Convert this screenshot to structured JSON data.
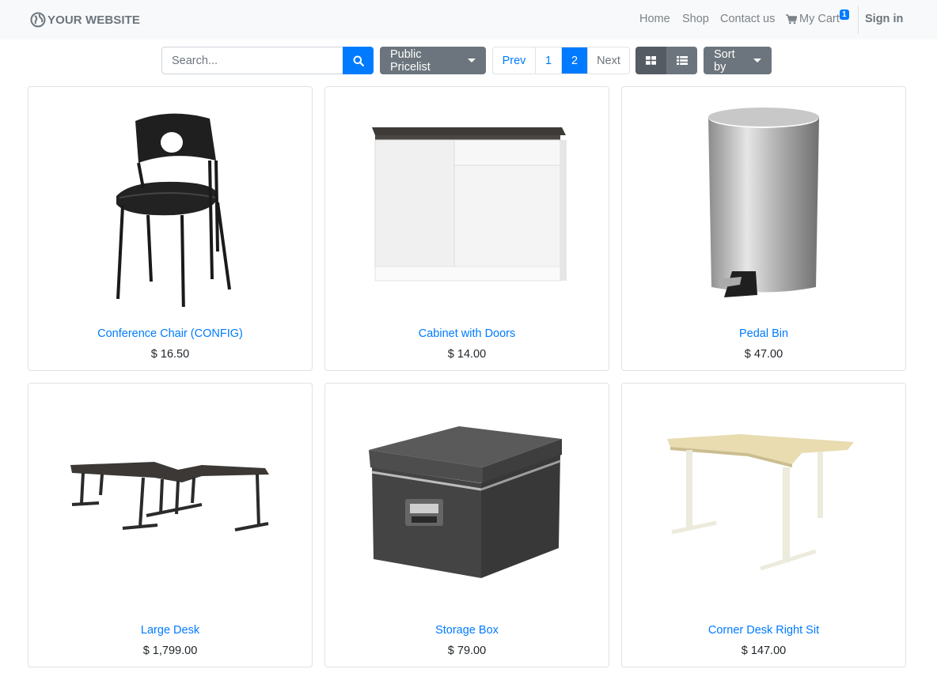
{
  "header": {
    "logo_text": "YOUR WEBSITE",
    "nav": {
      "home": "Home",
      "shop": "Shop",
      "contact": "Contact us",
      "cart": "My Cart",
      "cart_count": "1",
      "sign_in": "Sign in"
    }
  },
  "toolbar": {
    "search_placeholder": "Search...",
    "pricelist_label": "Public Pricelist",
    "pager": {
      "prev": "Prev",
      "pages": [
        "1",
        "2"
      ],
      "current": "2",
      "next": "Next"
    },
    "sort_label": "Sort by",
    "view_modes": [
      "grid-icon",
      "list-icon"
    ],
    "active_view": "grid-icon"
  },
  "products": [
    {
      "name": "Conference Chair (CONFIG)",
      "price": "$ 16.50",
      "image": "chair-image"
    },
    {
      "name": "Cabinet with Doors",
      "price": "$ 14.00",
      "image": "cabinet-image"
    },
    {
      "name": "Pedal Bin",
      "price": "$ 47.00",
      "image": "pedal-bin-image"
    },
    {
      "name": "Large Desk",
      "price": "$ 1,799.00",
      "image": "large-desk-image"
    },
    {
      "name": "Storage Box",
      "price": "$ 79.00",
      "image": "storage-box-image"
    },
    {
      "name": "Corner Desk Right Sit",
      "price": "$ 147.00",
      "image": "corner-desk-image"
    }
  ],
  "colors": {
    "primary": "#007bff",
    "secondary": "#6c757d",
    "header_bg": "#f8f9fa"
  }
}
